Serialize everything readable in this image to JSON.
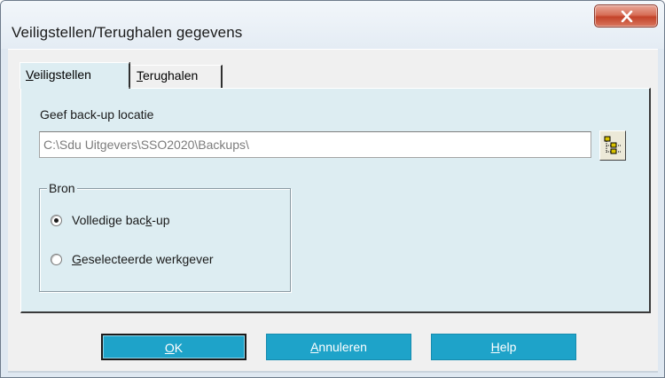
{
  "window": {
    "title": "Veiligstellen/Terughalen gegevens",
    "close_icon": "close-icon",
    "close_color": "#c4432a"
  },
  "tabs": [
    {
      "label": "Veiligstellen",
      "mnemonic_first": "V",
      "rest": "eiligstellen",
      "active": true
    },
    {
      "label": "Terughalen",
      "mnemonic_first": "T",
      "rest": "erughalen",
      "active": false
    }
  ],
  "location": {
    "label": "Geef back-up locatie",
    "value": "C:\\Sdu Uitgevers\\SSO2020\\Backups\\",
    "browse_icon": "folder-tree-icon"
  },
  "source_group": {
    "legend": "Bron",
    "options": [
      {
        "label": "Volledige back-up",
        "before": "Volledige bac",
        "mnemonic": "k",
        "after": "-up",
        "selected": true
      },
      {
        "label": "Geselecteerde werkgever",
        "before": "",
        "mnemonic": "G",
        "after": "eselecteerde werkgever",
        "selected": false
      }
    ]
  },
  "buttons": {
    "ok": {
      "label": "OK",
      "before": "",
      "mnemonic": "O",
      "after": "K"
    },
    "cancel": {
      "label": "Annuleren",
      "before": "",
      "mnemonic": "A",
      "after": "nnuleren"
    },
    "help": {
      "label": "Help",
      "before": "",
      "mnemonic": "H",
      "after": "elp"
    }
  },
  "colors": {
    "button_bg": "#1ea3c9",
    "panel_bg": "#ddedf2"
  }
}
